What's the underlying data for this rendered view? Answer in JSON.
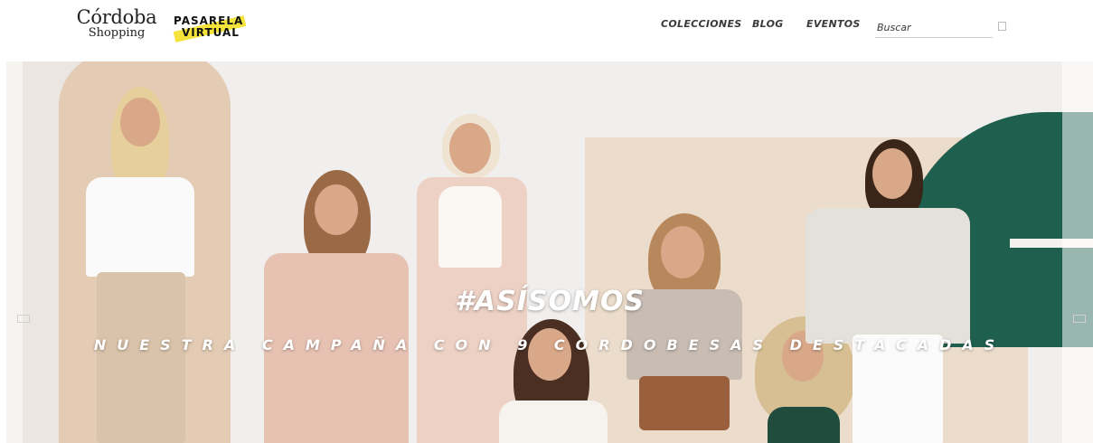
{
  "brand": {
    "cordoba_line1": "Córdoba",
    "cordoba_line2": "Shopping",
    "pasarela_line1": "PASARELA",
    "pasarela_line2": "VIRTUAL"
  },
  "nav": {
    "items": [
      {
        "label": "COLECCIONES"
      },
      {
        "label": "BLOG"
      },
      {
        "label": "EVENTOS"
      }
    ]
  },
  "search": {
    "placeholder": "Buscar",
    "icon": "search-icon"
  },
  "hero": {
    "title": "#ASÍSOMOS",
    "subtitle": "NUESTRA CAMPAÑA CON 9 CORDOBESAS DESTACADAS",
    "prev_icon": "chevron-left-icon",
    "next_icon": "chevron-right-icon"
  },
  "colors": {
    "accent_yellow": "#f3e33a",
    "nav_text": "#3a3a3a",
    "hero_bg": "#f1efed",
    "hero_green": "#1f5f4e",
    "hero_peach": "#e3cbb4"
  }
}
